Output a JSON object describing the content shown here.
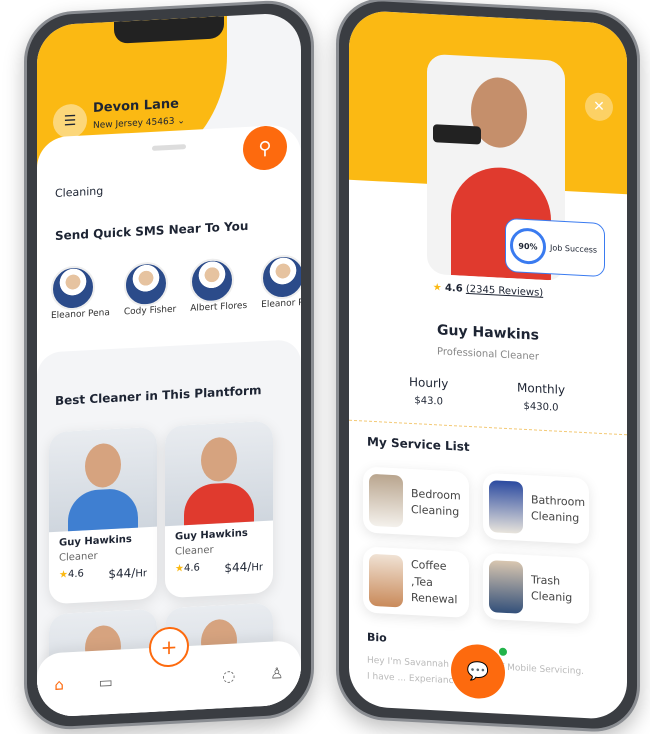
{
  "left": {
    "user_name": "Devon Lane",
    "location": "New Jersey 45463",
    "category": "Cleaning",
    "sms_title": "Send Quick SMS Near To You",
    "nearby": [
      "Eleanor Pena",
      "Cody Fisher",
      "Albert Flores",
      "Eleanor Pe"
    ],
    "best_title": "Best Cleaner in This Plantform",
    "cleaners": [
      {
        "name": "Guy Hawkins",
        "role": "Cleaner",
        "rating": "4.6",
        "price": "$44/",
        "unit": "Hr"
      },
      {
        "name": "Guy Hawkins",
        "role": "Cleaner",
        "rating": "4.6",
        "price": "$44/",
        "unit": "Hr"
      }
    ],
    "fab_label": "+",
    "nav_icons": [
      "home-icon",
      "calendar-icon",
      "chat-icon",
      "profile-icon"
    ]
  },
  "right": {
    "job_success_pct": "90%",
    "job_success_value": 90,
    "job_success_label": "Job Success",
    "rating": "4.6",
    "reviews": "(2345 Reviews)",
    "name": "Guy Hawkins",
    "title": "Professional Cleaner",
    "hourly_label": "Hourly",
    "hourly_price": "$43.0",
    "monthly_label": "Monthly",
    "monthly_price": "$430.0",
    "services_title": "My Service List",
    "services": [
      "Bedroom Cleaning",
      "Bathroom Cleaning",
      "Coffee ,Tea Renewal",
      "Trash Cleanig"
    ],
    "bio_title": "Bio",
    "bio_text": "Hey I'm Savannah ... Expert of Mobile Servicing. I have ... Experiance. Reard"
  },
  "colors": {
    "accent": "#fd6a0e",
    "yellow": "#fbb913"
  }
}
